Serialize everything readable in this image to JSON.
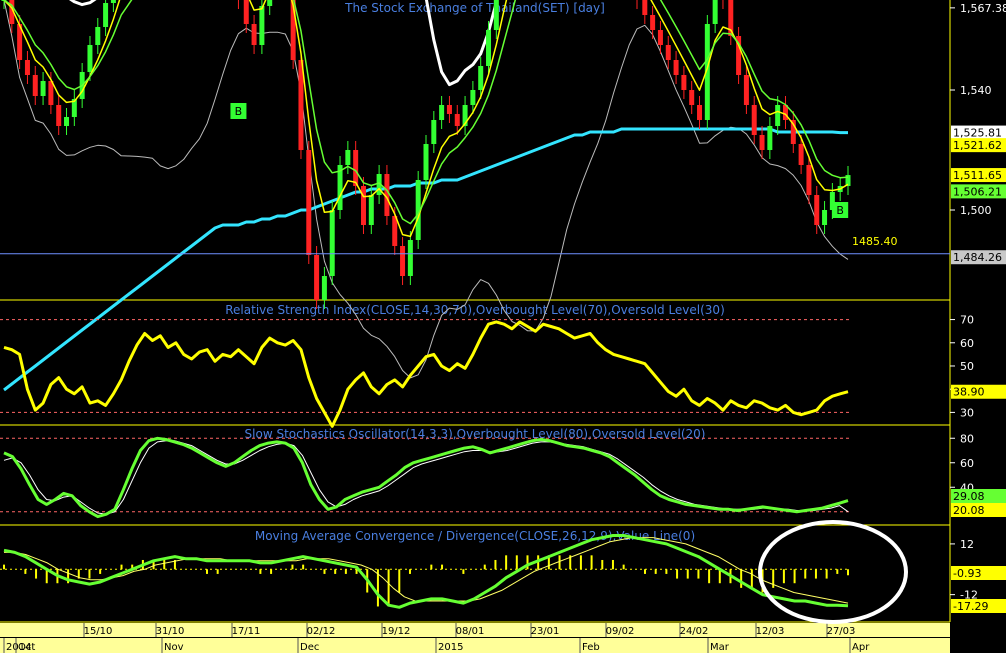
{
  "chart_data": [
    {
      "type": "candlestick",
      "title": "The Stock Exchange of Thailand(SET) [day]",
      "ylim": [
        1470,
        1570
      ],
      "yticks": [
        {
          "label": "1,567.38",
          "value": 1567.38
        },
        {
          "label": "1,540",
          "value": 1540
        },
        {
          "label": "1,500",
          "value": 1500
        }
      ],
      "price_tags": [
        {
          "label": "1,525.81",
          "value": 1525.81,
          "bg": "#ffffff",
          "fg": "#000000"
        },
        {
          "label": "1,521.62",
          "value": 1521.62,
          "bg": "#ffff00",
          "fg": "#000000"
        },
        {
          "label": "1,511.65",
          "value": 1511.65,
          "bg": "#ffff00",
          "fg": "#000000"
        },
        {
          "label": "1,506.21",
          "value": 1506.21,
          "bg": "#66ff33",
          "fg": "#000000"
        },
        {
          "label": "1,484.26",
          "value": 1484.26,
          "bg": "#c8c8c8",
          "fg": "#000000"
        }
      ],
      "reference_line": {
        "label": "1485.40",
        "value": 1485.4
      },
      "signals": [
        {
          "label": "B",
          "x": 30,
          "value": 1533
        },
        {
          "label": "B",
          "x": 107,
          "value": 1500
        }
      ],
      "closes": [
        1570,
        1562,
        1550,
        1545,
        1538,
        1543,
        1535,
        1528,
        1531,
        1537,
        1546,
        1555,
        1561,
        1569,
        1578,
        1588,
        1582,
        1586,
        1590,
        1595,
        1605,
        1598,
        1592,
        1586,
        1580,
        1585,
        1590,
        1586,
        1580,
        1575,
        1570,
        1562,
        1555,
        1568,
        1585,
        1590,
        1575,
        1550,
        1520,
        1485,
        1470,
        1478,
        1500,
        1515,
        1520,
        1508,
        1495,
        1505,
        1512,
        1498,
        1488,
        1478,
        1490,
        1510,
        1522,
        1530,
        1535,
        1532,
        1528,
        1535,
        1540,
        1548,
        1560,
        1575,
        1590,
        1600,
        1610,
        1620,
        1615,
        1608,
        1612,
        1618,
        1610,
        1605,
        1600,
        1595,
        1590,
        1585,
        1580,
        1578,
        1575,
        1570,
        1565,
        1560,
        1555,
        1550,
        1545,
        1540,
        1535,
        1530,
        1562,
        1575,
        1570,
        1558,
        1545,
        1535,
        1525,
        1520,
        1528,
        1535,
        1530,
        1522,
        1515,
        1505,
        1495,
        1500,
        1506,
        1508,
        1511.65
      ],
      "ma_slow": [
        1440,
        1442,
        1444,
        1446,
        1448,
        1450,
        1452,
        1454,
        1456,
        1458,
        1460,
        1462,
        1464,
        1466,
        1468,
        1470,
        1472,
        1474,
        1476,
        1478,
        1480,
        1482,
        1484,
        1486,
        1488,
        1490,
        1492,
        1494,
        1495,
        1495,
        1495,
        1496,
        1496,
        1497,
        1497,
        1498,
        1498,
        1499,
        1500,
        1500,
        1501,
        1502,
        1503,
        1504,
        1505,
        1506,
        1506,
        1507,
        1507,
        1507,
        1508,
        1508,
        1508,
        1509,
        1509,
        1509,
        1510,
        1510,
        1510,
        1511,
        1512,
        1513,
        1514,
        1515,
        1516,
        1517,
        1518,
        1519,
        1520,
        1521,
        1522,
        1523,
        1524,
        1525,
        1525,
        1526,
        1526,
        1526,
        1526,
        1527,
        1527,
        1527,
        1527,
        1527,
        1527,
        1527,
        1527,
        1527,
        1527,
        1527,
        1527,
        1527,
        1527,
        1527,
        1527,
        1527,
        1527,
        1527,
        1527,
        1526,
        1526,
        1526,
        1526,
        1526,
        1526,
        1526,
        1526,
        1525.8,
        1525.81
      ]
    },
    {
      "type": "line",
      "title": "Relative Strength Index(CLOSE,14,30,70),Overbought Level(70),Oversold Level(30)",
      "ylim": [
        25,
        78
      ],
      "yticks": [
        70,
        60,
        50,
        40,
        30
      ],
      "levels": [
        70,
        30
      ],
      "last_label": "38.90",
      "values": [
        58,
        57,
        55,
        40,
        31,
        34,
        42,
        45,
        40,
        38,
        41,
        34,
        35,
        33,
        38,
        44,
        52,
        59,
        64,
        61,
        63,
        58,
        60,
        55,
        53,
        56,
        57,
        52,
        55,
        54,
        57,
        54,
        51,
        58,
        62,
        60,
        59,
        61,
        57,
        45,
        36,
        30,
        24,
        31,
        40,
        44,
        47,
        41,
        38,
        42,
        44,
        41,
        46,
        50,
        54,
        55,
        50,
        48,
        51,
        49,
        55,
        62,
        68,
        69,
        68,
        66,
        69,
        67,
        65,
        68,
        67,
        66,
        64,
        62,
        63,
        64,
        60,
        57,
        55,
        54,
        53,
        52,
        51,
        47,
        43,
        39,
        37,
        40,
        35,
        33,
        36,
        34,
        31,
        35,
        33,
        32,
        35,
        34,
        32,
        31,
        33,
        30,
        29,
        30,
        31,
        35,
        37,
        38,
        38.9
      ]
    },
    {
      "type": "line",
      "title": "Slow Stochastics Oscillator(14,3,3),Overbought Level(80),Oversold Level(20)",
      "ylim": [
        10,
        90
      ],
      "yticks": [
        80,
        60,
        40
      ],
      "levels": [
        80,
        20
      ],
      "last_labels": [
        "29.08",
        "20.08"
      ],
      "k_values": [
        68,
        65,
        55,
        42,
        30,
        26,
        30,
        35,
        33,
        25,
        20,
        16,
        18,
        22,
        38,
        55,
        70,
        78,
        80,
        79,
        77,
        75,
        72,
        68,
        64,
        60,
        57,
        60,
        65,
        70,
        74,
        76,
        77,
        76,
        72,
        60,
        42,
        30,
        22,
        24,
        30,
        33,
        36,
        38,
        40,
        45,
        50,
        56,
        60,
        62,
        64,
        66,
        68,
        70,
        72,
        73,
        71,
        68,
        70,
        72,
        74,
        76,
        78,
        79,
        78,
        76,
        74,
        73,
        72,
        70,
        68,
        65,
        60,
        55,
        50,
        44,
        38,
        33,
        30,
        28,
        26,
        25,
        24,
        23,
        22,
        22,
        21,
        22,
        23,
        24,
        23,
        22,
        21,
        20,
        21,
        22,
        23,
        25,
        27,
        29.08
      ],
      "d_values": [
        62,
        64,
        60,
        50,
        38,
        30,
        29,
        32,
        33,
        28,
        23,
        19,
        18,
        20,
        30,
        45,
        60,
        72,
        77,
        78,
        78,
        76,
        74,
        70,
        66,
        62,
        59,
        59,
        62,
        66,
        70,
        73,
        75,
        76,
        74,
        66,
        52,
        38,
        28,
        24,
        26,
        30,
        33,
        35,
        37,
        41,
        46,
        51,
        56,
        59,
        61,
        63,
        65,
        67,
        69,
        70,
        70,
        69,
        69,
        70,
        72,
        74,
        76,
        77,
        77,
        76,
        75,
        74,
        73,
        71,
        69,
        67,
        63,
        58,
        53,
        48,
        42,
        37,
        33,
        30,
        28,
        26,
        25,
        24,
        23,
        22,
        22,
        22,
        22,
        23,
        23,
        22,
        22,
        21,
        21,
        21,
        22,
        23,
        25,
        20.08
      ]
    },
    {
      "type": "line",
      "title": "Moving Average Convergence / Divergence(CLOSE,26,12,9),Value Line(0)",
      "ylim": [
        -24,
        20
      ],
      "yticks": [
        {
          "label": "12",
          "value": 12
        },
        {
          "label": "-12",
          "value": -12
        }
      ],
      "levels": [
        0
      ],
      "last_labels": [
        "-0.93",
        "-17.29"
      ],
      "macd_values": [
        9,
        8,
        6,
        3,
        0,
        -3,
        -5,
        -6,
        -7,
        -6,
        -4,
        -2,
        0,
        2,
        4,
        5,
        6,
        5,
        5,
        4,
        4,
        4,
        4,
        4,
        3,
        3,
        4,
        5,
        6,
        5,
        4,
        3,
        2,
        1,
        -5,
        -12,
        -17,
        -18,
        -16,
        -15,
        -14,
        -14,
        -15,
        -16,
        -14,
        -11,
        -8,
        -4,
        -1,
        2,
        4,
        6,
        8,
        10,
        12,
        14,
        15,
        16,
        16,
        15,
        14,
        13,
        12,
        10,
        8,
        6,
        3,
        0,
        -3,
        -6,
        -9,
        -12,
        -13,
        -14,
        -15,
        -15,
        -16,
        -17,
        -17,
        -17.29
      ],
      "signal_values": [
        8,
        8,
        7,
        5,
        3,
        0,
        -2,
        -4,
        -5,
        -5,
        -4,
        -3,
        -1,
        0,
        2,
        3,
        4,
        5,
        5,
        5,
        5,
        4,
        4,
        4,
        4,
        4,
        4,
        4,
        5,
        5,
        5,
        4,
        3,
        2,
        0,
        -4,
        -9,
        -13,
        -15,
        -15,
        -15,
        -15,
        -15,
        -15,
        -14,
        -12,
        -10,
        -7,
        -4,
        -1,
        1,
        3,
        5,
        7,
        9,
        11,
        13,
        14,
        15,
        15,
        15,
        14,
        13,
        12,
        10,
        8,
        6,
        3,
        0,
        -2,
        -5,
        -7,
        -9,
        -11,
        -12,
        -13,
        -14,
        -15,
        -16,
        -0.93
      ]
    }
  ],
  "x_axis": {
    "date_labels": [
      "15/10",
      "31/10",
      "17/11",
      "02/12",
      "19/12",
      "08/01",
      "23/01",
      "09/02",
      "24/02",
      "12/03",
      "27/03"
    ],
    "period_labels": [
      "2014",
      "Oct",
      "Nov",
      "Dec",
      "2015",
      "Feb",
      "Mar",
      "Apr"
    ]
  },
  "colors": {
    "bull": "#33ff33",
    "bear": "#ff2222",
    "ma_fast": "#ffff00",
    "ma_mid": "#66ff33",
    "band": "#ffffff",
    "ma_long": "#33e5ff",
    "rsi": "#ffff00",
    "level": "#ff6666",
    "title": "#4a7fe0",
    "panel_border": "#ffff00"
  }
}
